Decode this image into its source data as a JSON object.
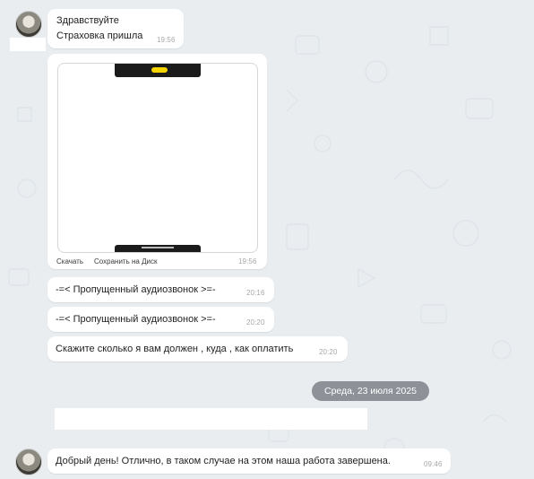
{
  "messages": [
    {
      "lines": [
        "Здравствуйте",
        "Страховка пришла"
      ],
      "time": "19:56"
    },
    {
      "type": "image",
      "caption_links": [
        "Скачать",
        "Сохранить на Диск"
      ],
      "time": "19:56"
    },
    {
      "text": "-=< Пропущенный аудиозвонок >=-",
      "time": "20:16"
    },
    {
      "text": "-=< Пропущенный аудиозвонок >=-",
      "time": "20:20"
    },
    {
      "text": "Скажите сколько я вам должен , куда , как оплатить",
      "time": "20:20"
    },
    {
      "text": "Добрый день! Отлично, в таком случае на этом наша работа завершена.",
      "time": "09:46"
    }
  ],
  "date_separator": "Среда, 23 июля 2025",
  "colors": {
    "background": "#e9edf0",
    "bubble": "#ffffff",
    "date_chip": "#8e9298",
    "time": "#a7a7a7",
    "phone_pill": "#f5d400"
  },
  "icons": [
    "avatar",
    "phone-screenshot-preview"
  ]
}
